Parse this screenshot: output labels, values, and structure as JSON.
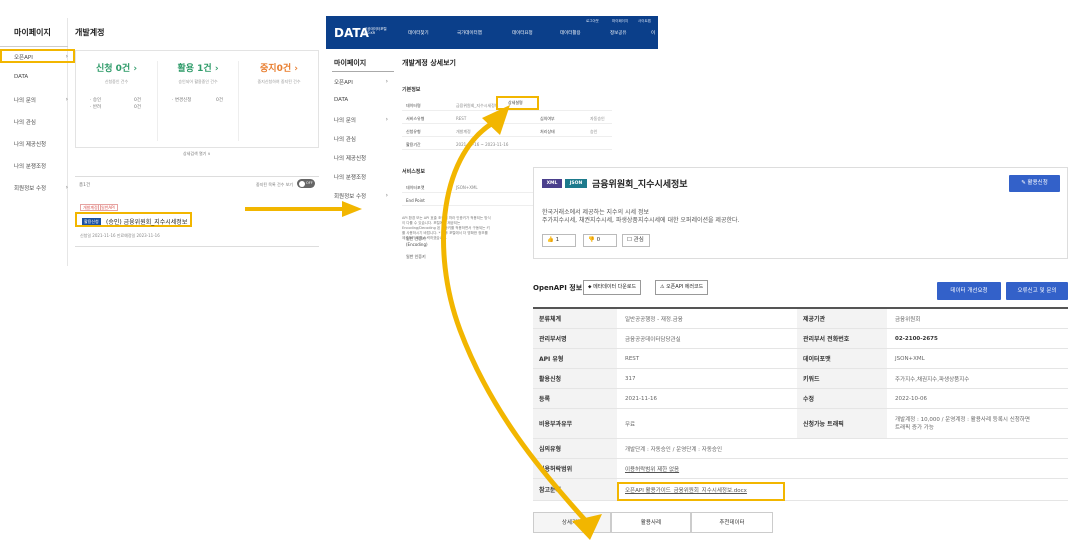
{
  "colors": {
    "highlight": "#f2b600",
    "nav_blue": "#0b3f8a",
    "button_blue": "#3361c9",
    "green": "#2e9b69",
    "orange": "#e87d2e"
  },
  "panel1": {
    "side_title": "마이페이지",
    "menu": [
      {
        "label": "오픈API",
        "chev": true
      },
      {
        "label": "DATA",
        "chev": false
      },
      {
        "label": "나의 문의",
        "chev": true
      },
      {
        "label": "나의 관심",
        "chev": false
      },
      {
        "label": "나의 제공신청",
        "chev": false
      },
      {
        "label": "나의 분쟁조정",
        "chev": false
      },
      {
        "label": "회원정보 수정",
        "chev": true
      }
    ],
    "main_title": "개발계정",
    "stats": [
      {
        "num": "신청 0건 ›",
        "sub": "신청중인 건수",
        "lines": [
          "· 승인",
          "· 반려"
        ],
        "vals": [
          "0건",
          "0건"
        ]
      },
      {
        "num": "활용 1건 ›",
        "sub": "승인되어 활용중인 건수",
        "lines": [
          "· 변경신청"
        ],
        "vals": [
          "0건"
        ]
      },
      {
        "num": "중지0건 ›",
        "sub": "중지신청하여 중지된 건수",
        "lines": [],
        "vals": []
      }
    ],
    "detail_link": "상세검색 열기 ∨",
    "list_head": "총1건",
    "toggle_label": "중지된 목록 건수 보기",
    "toggle_state": "OFF",
    "tags": [
      "개발계정",
      "일반API"
    ],
    "item_tag": "활용신청",
    "item_name": "(승인) 금융위원회_지수시세정보",
    "item_meta": "신청일  2021-11-16   만료예정일  2023-11-16"
  },
  "panel2": {
    "logo": "DATA",
    "logo_sub": [
      "공공데이터포털",
      "GO.KR"
    ],
    "gnb": [
      "데이터찾기",
      "국가데이터맵",
      "데이터요청",
      "데이터활용",
      "정보공유",
      "이"
    ],
    "util": [
      "로그아웃",
      "마이페이지",
      "사이트맵"
    ],
    "side_title": "마이페이지",
    "menu": [
      "오픈API",
      "DATA",
      "나의 문의",
      "나의 관심",
      "나의 제공신청",
      "나의 분쟁조정",
      "회원정보 수정"
    ],
    "main_title": "개발계정 상세보기",
    "basic_title": "기본정보",
    "rows": [
      {
        "lab": "데이터명",
        "val": "금융위원회_지수시세정보",
        "lab2": "",
        "val2": ""
      },
      {
        "lab": "서비스유형",
        "val": "REST",
        "lab2": "심의여부",
        "val2": "자동승인"
      },
      {
        "lab": "신청유형",
        "val": "개발계정",
        "lab2": "처리상태",
        "val2": "승인"
      },
      {
        "lab": "활용기간",
        "val": "2021-11-16 ~ 2023-11-16",
        "lab2": "",
        "val2": ""
      }
    ],
    "apply_btn": "상세설명",
    "svc_title": "서비스정보",
    "svc_rows": [
      {
        "lab": "데이터포맷",
        "val": "JSON+XML"
      },
      {
        "lab": "End Point",
        "val": ""
      }
    ],
    "svc_desc": "API 환경 또는 API 호출 조건에 따라 인증키가 적용되는 방식이 다를 수 있습니다. 포털에서 제공되는 Encoding/Decoding 된 인증키를 적용하면서 구동되는 키를 사용하시기 바랍니다. * 향후 포털에서 더 명확한 정보를 제공하기 위해 노력하겠습니다.",
    "extra_rows": [
      "일반 인증키 (Encoding)",
      "일반 인증키"
    ]
  },
  "panel3": {
    "badges": [
      "XML",
      "JSON"
    ],
    "title": "금융위원회_지수시세정보",
    "apply_button": "✎ 활용신청",
    "desc_lines": [
      "한국거래소에서 제공하는 지수의 시세 정보",
      "주가지수시세, 채권지수시세, 파생상품지수시세에 대한 오퍼레이션을 제공한다."
    ],
    "like": "👍 1",
    "dislike": "👎 0",
    "interest": "☐ 관심",
    "openapi_title": "OpenAPI 정보",
    "meta_download": "⬥ 메타데이터 다운로드",
    "error_code": "⚠ 오픈API 에러코드",
    "improve_btn": "데이터 개선요청",
    "report_btn": "오류신고 및 문의",
    "table": [
      {
        "h1": "분류체계",
        "v1": "일반공공행정 - 재정.금융",
        "h2": "제공기관",
        "v2": "금융위원회"
      },
      {
        "h1": "관리부서명",
        "v1": "금융공공데이터담당관실",
        "h2": "관리부서 전화번호",
        "v2": "02-2100-2675"
      },
      {
        "h1": "API 유형",
        "v1": "REST",
        "h2": "데이터포맷",
        "v2": "JSON+XML"
      },
      {
        "h1": "활용신청",
        "v1": "317",
        "h2": "키워드",
        "v2": "주가지수,채권지수,파생상품지수"
      },
      {
        "h1": "등록",
        "v1": "2021-11-16",
        "h2": "수정",
        "v2": "2022-10-06"
      },
      {
        "h1": "비용부과유무",
        "v1": "무료",
        "h2": "신청가능 트래픽",
        "v2": "개발계정 : 10,000 / 운영계정 : 활용사례 등록시 신청하면",
        "v2b": "트래픽 증가 가능"
      },
      {
        "h1": "심의유형",
        "v1": "개발단계 : 자동승인 / 운영단계 : 자동승인"
      },
      {
        "h1": "이용허락범위",
        "v1": "이용허락범위 제한 없음"
      },
      {
        "h1": "참고문서",
        "v1": "오픈API 활용가이드_금융위원회_지수시세정보.docx"
      }
    ],
    "tabs": [
      "상세기능",
      "활용사례",
      "추천데이터"
    ]
  }
}
